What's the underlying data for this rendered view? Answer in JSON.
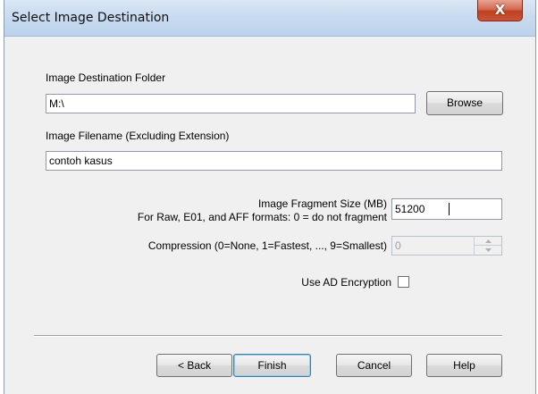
{
  "window": {
    "title": "Select Image Destination",
    "close_label": "X"
  },
  "form": {
    "destination_folder_label": "Image Destination Folder",
    "destination_folder_value": "M:\\",
    "browse_label": "Browse",
    "filename_label": "Image Filename (Excluding Extension)",
    "filename_value": "contoh kasus",
    "fragment_label_line1": "Image Fragment Size (MB)",
    "fragment_label_line2": "For Raw, E01, and AFF formats: 0 = do not fragment",
    "fragment_value": "51200",
    "compression_label": "Compression (0=None, 1=Fastest, ..., 9=Smallest)",
    "compression_value": "0",
    "encryption_label": "Use AD Encryption",
    "encryption_checked": false
  },
  "buttons": {
    "back": "< Back",
    "finish": "Finish",
    "cancel": "Cancel",
    "help": "Help"
  },
  "colors": {
    "window_bg": "#f0f0f0",
    "titlebar": "#c9dbef",
    "close_button": "#c9543a",
    "default_button_border": "#3c7fb1"
  }
}
